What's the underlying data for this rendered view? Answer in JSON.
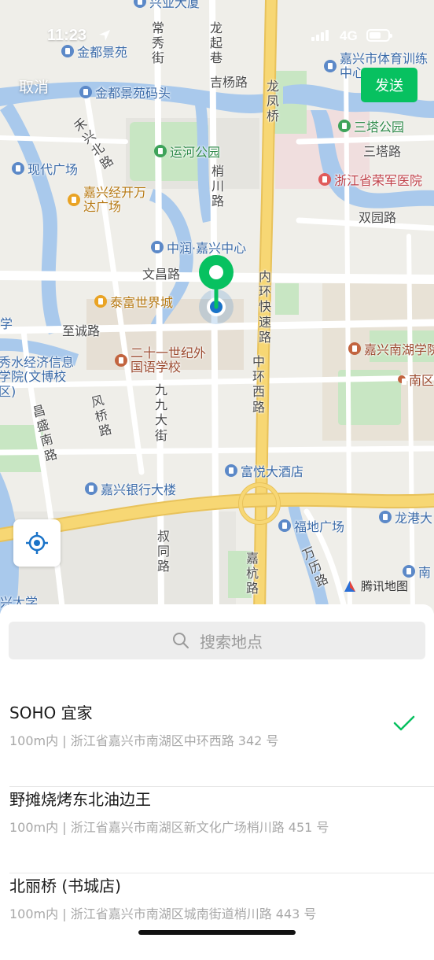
{
  "status_bar": {
    "time": "11:23",
    "network": "4G"
  },
  "nav": {
    "cancel_label": "取消",
    "send_label": "发送"
  },
  "map": {
    "roads": [
      "常秀街",
      "龙起巷",
      "吉杨路",
      "龙凤桥",
      "禾兴北路",
      "梢川路",
      "文昌路",
      "内环快速路",
      "至诚路",
      "中环西路",
      "九九大街",
      "风桥路",
      "昌盛南路",
      "叔同路",
      "嘉杭路",
      "万历路",
      "双园路",
      "三塔路"
    ],
    "pois": [
      {
        "name": "兴业大厦",
        "type": "blue"
      },
      {
        "name": "金都景苑",
        "type": "blue"
      },
      {
        "name": "金都景苑码头",
        "type": "blue"
      },
      {
        "name": "嘉兴市体育训练中心",
        "type": "blue"
      },
      {
        "name": "三塔公园",
        "type": "green"
      },
      {
        "name": "运河公园",
        "type": "green"
      },
      {
        "name": "现代广场",
        "type": "blue"
      },
      {
        "name": "浙江省荣军医院",
        "type": "red"
      },
      {
        "name": "嘉兴经开万达广场",
        "type": "orange"
      },
      {
        "name": "中润·嘉兴中心",
        "type": "blue"
      },
      {
        "name": "泰富世界城",
        "type": "orange"
      },
      {
        "name": "嘉兴南湖学院",
        "type": "brown"
      },
      {
        "name": "二十一世纪外国语学校",
        "type": "brown"
      },
      {
        "name": "秀水经济信息学院(文博校区)",
        "type": "blue"
      },
      {
        "name": "南区",
        "type": "brown"
      },
      {
        "name": "富悦大酒店",
        "type": "blue"
      },
      {
        "name": "嘉兴银行大楼",
        "type": "blue"
      },
      {
        "name": "福地广场",
        "type": "blue"
      },
      {
        "name": "龙港大",
        "type": "blue"
      },
      {
        "name": "南",
        "type": "blue"
      },
      {
        "name": "兴大学",
        "type": "blue"
      },
      {
        "name": "学",
        "type": "blue"
      }
    ],
    "attribution": "腾讯地图"
  },
  "search": {
    "placeholder": "搜索地点"
  },
  "results": [
    {
      "name": "SOHO 宜家",
      "address": "100m内 | 浙江省嘉兴市南湖区中环西路 342 号",
      "selected": true
    },
    {
      "name": "野摊烧烤东北油边王",
      "address": "100m内 | 浙江省嘉兴市南湖区新文化广场梢川路 451 号",
      "selected": false
    },
    {
      "name": "北丽桥 (书城店)",
      "address": "100m内 | 浙江省嘉兴市南湖区城南街道梢川路 443 号",
      "selected": false
    }
  ],
  "colors": {
    "accent": "#07c160",
    "pin": "#07c160",
    "location": "#1a73c8"
  },
  "icons": [
    "location-arrow-icon",
    "signal-icon",
    "battery-icon",
    "locate-icon",
    "tencent-map-logo-icon",
    "search-icon",
    "checkmark-icon",
    "map-pin-icon",
    "current-location-icon"
  ]
}
